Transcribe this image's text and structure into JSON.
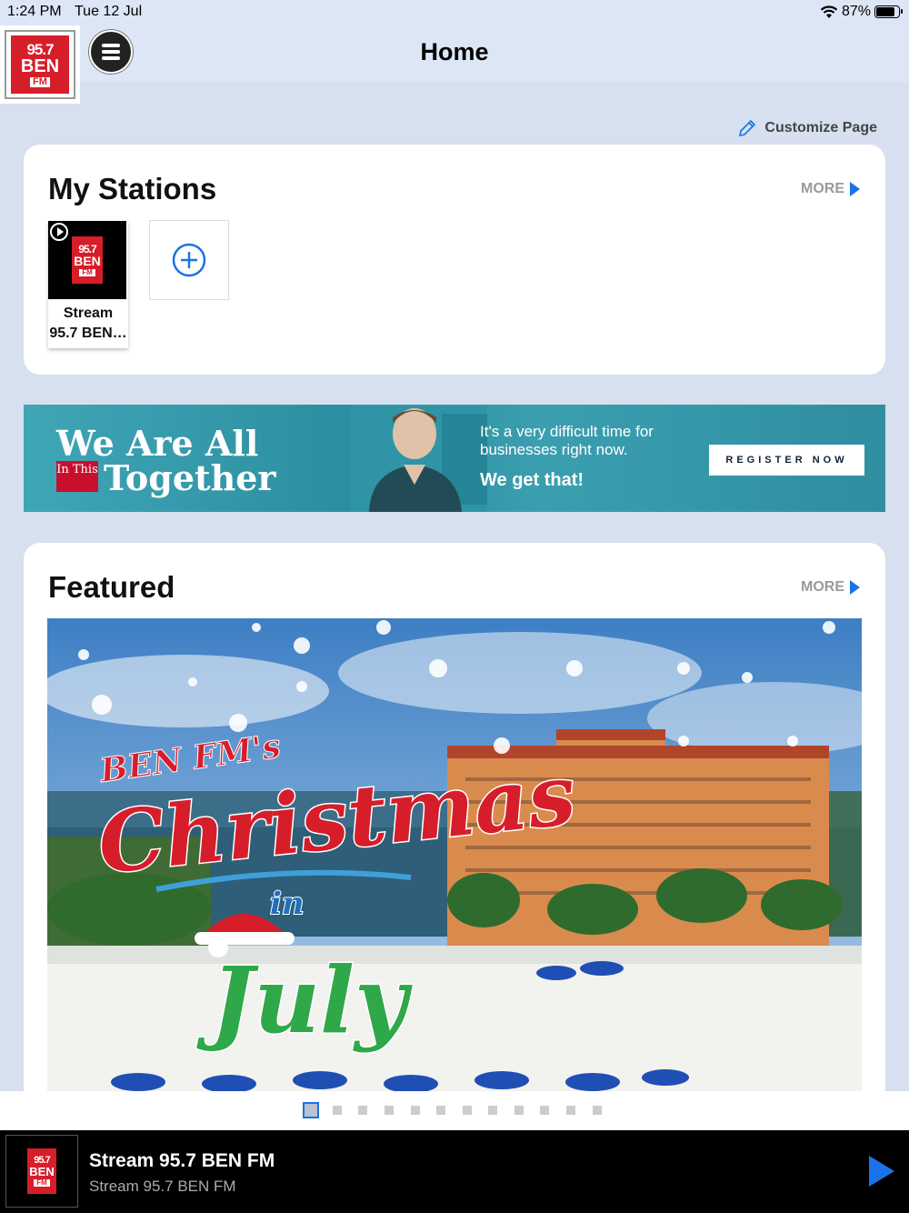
{
  "status": {
    "time": "1:24 PM",
    "date": "Tue 12 Jul",
    "battery": "87%",
    "battery_level": 0.87
  },
  "header": {
    "title": "Home"
  },
  "logo": {
    "line1": "95.7",
    "line2": "BEN",
    "line3": "FM"
  },
  "customize": {
    "label": "Customize Page"
  },
  "my_stations": {
    "title": "My Stations",
    "more_label": "MORE",
    "stations": [
      {
        "name_line1": "Stream",
        "name_line2": "95.7 BEN…"
      }
    ]
  },
  "ad": {
    "line1": "We Are All",
    "tag": "In This",
    "line2": "Together",
    "copy": "It's a very difficult time for businesses right now.",
    "copy_bold": "We get that!",
    "cta": "REGISTER NOW"
  },
  "featured": {
    "title": "Featured",
    "more_label": "MORE",
    "image_text1": "BEN FM's",
    "image_text2": "Christmas",
    "image_text3": "in",
    "image_text4": "July",
    "page_count": 12,
    "active_page": 1
  },
  "player": {
    "title": "Stream 95.7 BEN FM",
    "subtitle": "Stream 95.7 BEN FM"
  },
  "colors": {
    "accent": "#1a73e8",
    "brand_red": "#d61e2a",
    "background": "#d6e0ef"
  }
}
